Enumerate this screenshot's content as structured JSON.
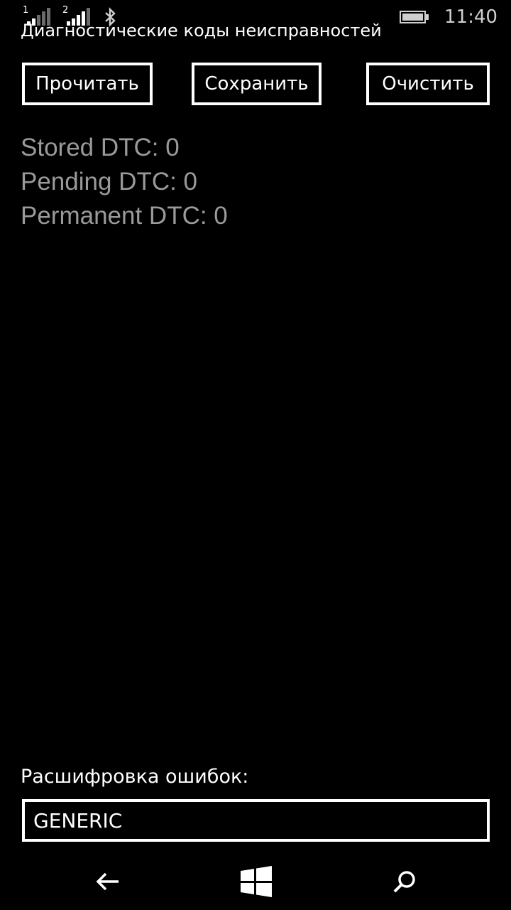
{
  "status_bar": {
    "sim1_label": "1",
    "sim2_label": "2",
    "time": "11:40",
    "icons": [
      "signal-icon",
      "signal-icon",
      "bluetooth-icon",
      "battery-icon"
    ]
  },
  "page": {
    "title": "Диагностические коды неисправностей"
  },
  "toolbar": {
    "read_label": "Прочитать",
    "save_label": "Сохранить",
    "clear_label": "Очистить"
  },
  "dtc": {
    "stored": "Stored DTC: 0",
    "pending": "Pending DTC: 0",
    "permanent": "Permanent DTC: 0"
  },
  "decode": {
    "label": "Расшифровка ошибок:",
    "selected": "GENERIC"
  },
  "nav": {
    "icons": [
      "back-arrow-icon",
      "windows-logo-icon",
      "search-icon"
    ]
  },
  "colors": {
    "background": "#000000",
    "foreground": "#ffffff",
    "dim_text": "#9a9a9a"
  }
}
